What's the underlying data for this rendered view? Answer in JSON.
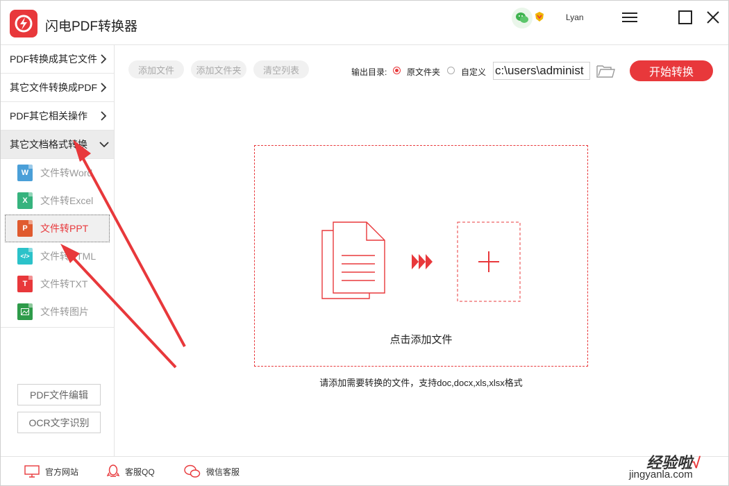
{
  "app": {
    "title": "闪电PDF转换器",
    "username": "Lyan",
    "accent": "#e8383b"
  },
  "sidebar": {
    "categories": [
      {
        "label": "PDF转换成其它文件"
      },
      {
        "label": "其它文件转换成PDF"
      },
      {
        "label": "PDF其它相关操作"
      },
      {
        "label": "其它文档格式转换"
      }
    ],
    "sub_items": [
      {
        "label": "文件转Word",
        "icon": "word-file-icon",
        "badge": "W",
        "color": "#4a9fd8"
      },
      {
        "label": "文件转Excel",
        "icon": "excel-file-icon",
        "badge": "X",
        "color": "#36b37e"
      },
      {
        "label": "文件转PPT",
        "icon": "ppt-file-icon",
        "badge": "P",
        "color": "#e05b2f"
      },
      {
        "label": "文件转HTML",
        "icon": "html-file-icon",
        "badge": "</>",
        "color": "#2bc2c9"
      },
      {
        "label": "文件转TXT",
        "icon": "txt-file-icon",
        "badge": "T",
        "color": "#e8383b"
      },
      {
        "label": "文件转图片",
        "icon": "image-file-icon",
        "badge": "",
        "color": "#2e9b4a"
      }
    ],
    "pdf_edit_label": "PDF文件编辑",
    "ocr_label": "OCR文字识别"
  },
  "toolbar": {
    "add_file": "添加文件",
    "add_folder": "添加文件夹",
    "clear_list": "清空列表",
    "output_label": "输出目录:",
    "option_original": "原文件夹",
    "option_custom": "自定义",
    "path_value": "c:\\users\\administ",
    "start_label": "开始转换"
  },
  "dropzone": {
    "text": "点击添加文件",
    "hint": "请添加需要转换的文件，支持doc,docx,xls,xlsx格式"
  },
  "footer": {
    "website": "官方网站",
    "qq": "客服QQ",
    "wechat": "微信客服"
  },
  "watermark": {
    "main": "经验啦",
    "sub": "jingyanla.com"
  }
}
